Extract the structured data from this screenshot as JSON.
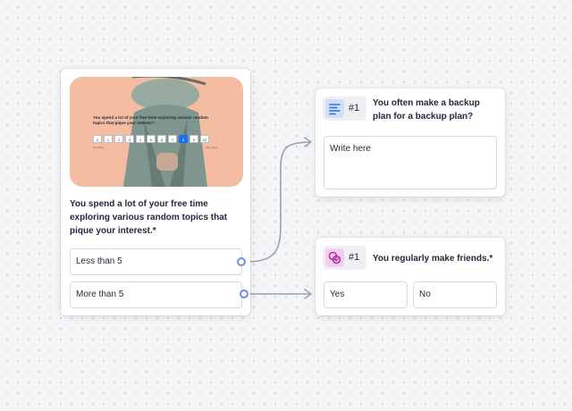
{
  "question_card": {
    "cover_question": "You spend a lot of your free time exploring various random topics that pique your interest.*",
    "scale_values": [
      "0",
      "1",
      "2",
      "3",
      "4",
      "5",
      "6",
      "7",
      "8",
      "9",
      "10"
    ],
    "scale_selected": "8",
    "scale_low": "Not likely",
    "scale_high": "Very likely",
    "question": "You spend a lot of your free time exploring various random topics that pique your interest.*",
    "choices": [
      "Less than 5",
      "More than 5"
    ]
  },
  "backup_card": {
    "icon": "text-lines-icon",
    "number": "#1",
    "title": "You often make a backup plan for a backup plan?",
    "placeholder": "Write here"
  },
  "friends_card": {
    "icon": "multiple-choice-icon",
    "number": "#1",
    "title": "You regularly make friends.*",
    "options": [
      "Yes",
      "No"
    ]
  },
  "colors": {
    "accent": "#1a6ff3",
    "connector": "#9aa1ad",
    "port": "#6d8de6",
    "cover_bg": "#f4bca0"
  }
}
